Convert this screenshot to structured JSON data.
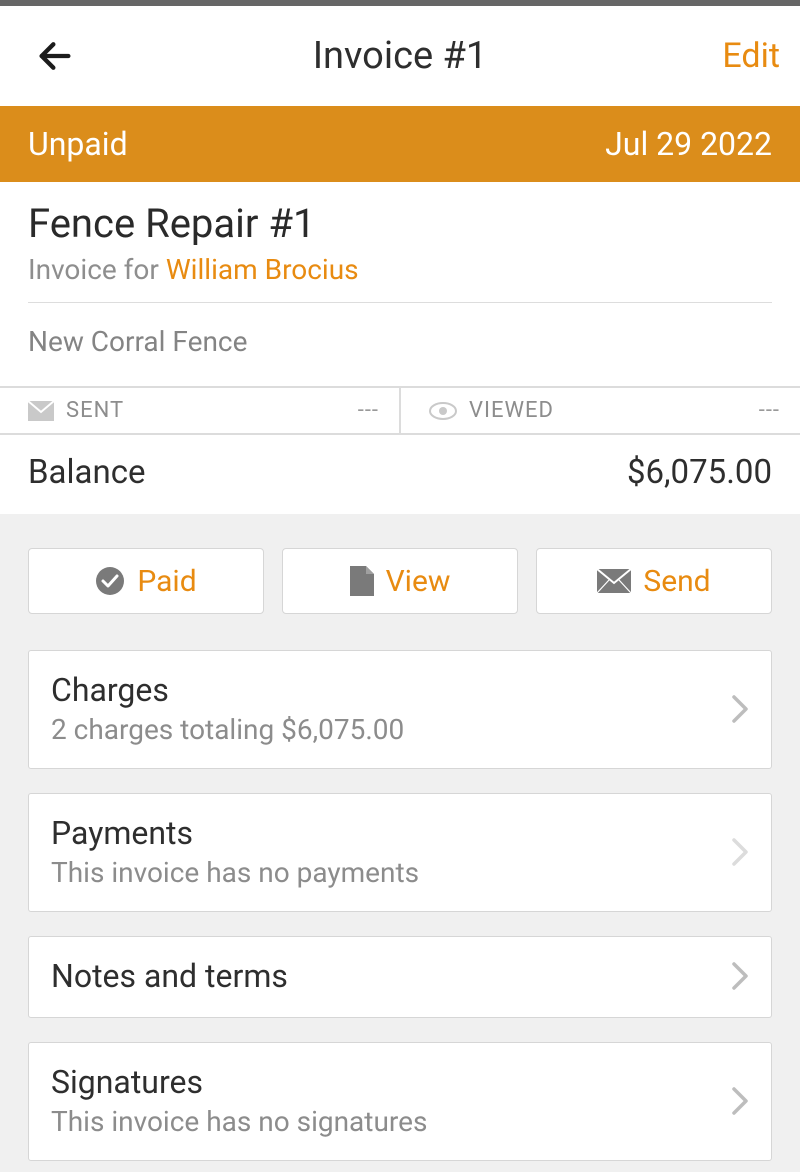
{
  "header": {
    "title": "Invoice #1",
    "edit_label": "Edit"
  },
  "status": {
    "state": "Unpaid",
    "date": "Jul 29 2022"
  },
  "job": {
    "title": "Fence Repair #1",
    "invoice_for_prefix": "Invoice for ",
    "client_name": "William Brocius",
    "description": "New Corral Fence"
  },
  "sent_viewed": {
    "sent_label": "SENT",
    "sent_value": "---",
    "viewed_label": "VIEWED",
    "viewed_value": "---"
  },
  "balance": {
    "label": "Balance",
    "amount": "$6,075.00"
  },
  "actions": {
    "paid": "Paid",
    "view": "View",
    "send": "Send"
  },
  "sections": {
    "charges": {
      "title": "Charges",
      "subtitle": "2 charges totaling $6,075.00"
    },
    "payments": {
      "title": "Payments",
      "subtitle": "This invoice has no payments"
    },
    "notes": {
      "title": "Notes and terms"
    },
    "signatures": {
      "title": "Signatures",
      "subtitle": "This invoice has no signatures"
    }
  }
}
